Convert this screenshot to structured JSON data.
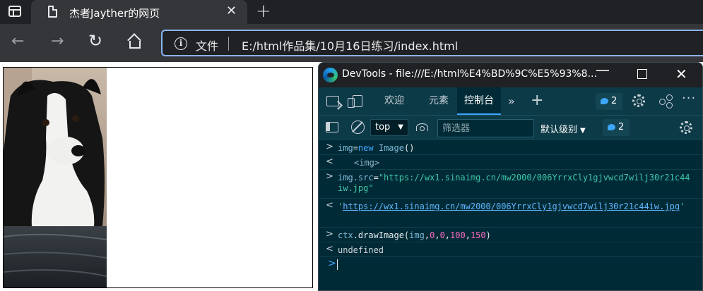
{
  "browser": {
    "tab": {
      "title": "杰者Jayther的网页"
    },
    "address_bar": {
      "label": "文件",
      "url": "E:/html作品集/10月16日练习/index.html"
    }
  },
  "devtools": {
    "window_title": "DevTools - file:///E:/html%E4%BD%9C%E5%93%8...",
    "tabs": [
      "欢迎",
      "元素",
      "控制台"
    ],
    "active_tab": "控制台",
    "issues_count": "2",
    "context": "top",
    "filter_placeholder": "筛选器",
    "log_level": "默认级别",
    "filter_issues_count": "2"
  },
  "console": {
    "lines": [
      {
        "gutter": ">",
        "var": "img",
        "eq": "=",
        "kw1": "new",
        "kw2": "Image",
        "rest": "()"
      },
      {
        "gutter": "<",
        "value": "<img>"
      },
      {
        "gutter": ">",
        "var": "img",
        "prop": ".src",
        "eq": "=",
        "str": "\"https://wx1.sinaimg.cn/mw2000/006YrrxCly1gjvwcd7wilj30r21c44iw.jpg\""
      },
      {
        "gutter": "<",
        "q1": "'",
        "link": "https://wx1.sinaimg.cn/mw2000/006YrrxCly1gjvwcd7wilj30r21c44iw.jpg",
        "q2": "'"
      },
      {
        "gutter": ">",
        "var": "ctx",
        "method": ".drawImage(",
        "arg1": "img",
        "sep1": ",",
        "n1": "0",
        "sep2": ",",
        "n2": "0",
        "sep3": ",",
        "n3": "100",
        "sep4": ",",
        "n4": "150",
        "close": ")"
      },
      {
        "gutter": "<",
        "value": "undefined"
      }
    ],
    "prompt": ">"
  },
  "colors": {
    "browser_frame": "#202124",
    "toolbar": "#35363a",
    "devtools_bg": "#002b36",
    "devtools_bar": "#0d3a47",
    "accent": "#3ea6ff"
  }
}
